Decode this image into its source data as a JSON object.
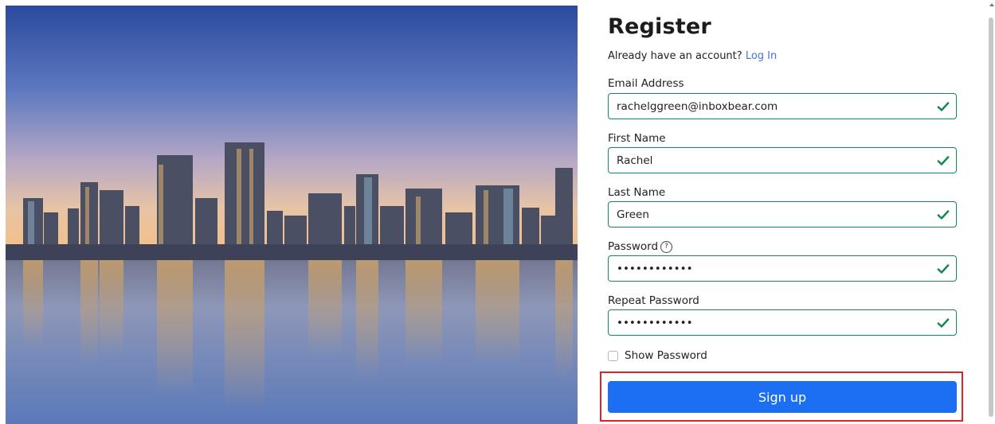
{
  "page": {
    "title": "Register",
    "login_prompt": "Already have an account?",
    "login_link": "Log In"
  },
  "fields": {
    "email": {
      "label": "Email Address",
      "value": "rachelggreen@inboxbear.com"
    },
    "first_name": {
      "label": "First Name",
      "value": "Rachel"
    },
    "last_name": {
      "label": "Last Name",
      "value": "Green"
    },
    "password": {
      "label": "Password",
      "value": "••••••••••••",
      "help_glyph": "?"
    },
    "repeat_password": {
      "label": "Repeat Password",
      "value": "••••••••••••"
    }
  },
  "show_password": {
    "label": "Show Password",
    "checked": false
  },
  "submit": {
    "label": "Sign up"
  },
  "colors": {
    "valid": "#198754",
    "primary": "#1c6ef2",
    "highlight": "#d7262b",
    "link": "#4d6fd8"
  },
  "icons": {
    "valid": "check-icon",
    "help": "question-circle-icon"
  },
  "image": {
    "subject": "city-skyline-reflection"
  }
}
